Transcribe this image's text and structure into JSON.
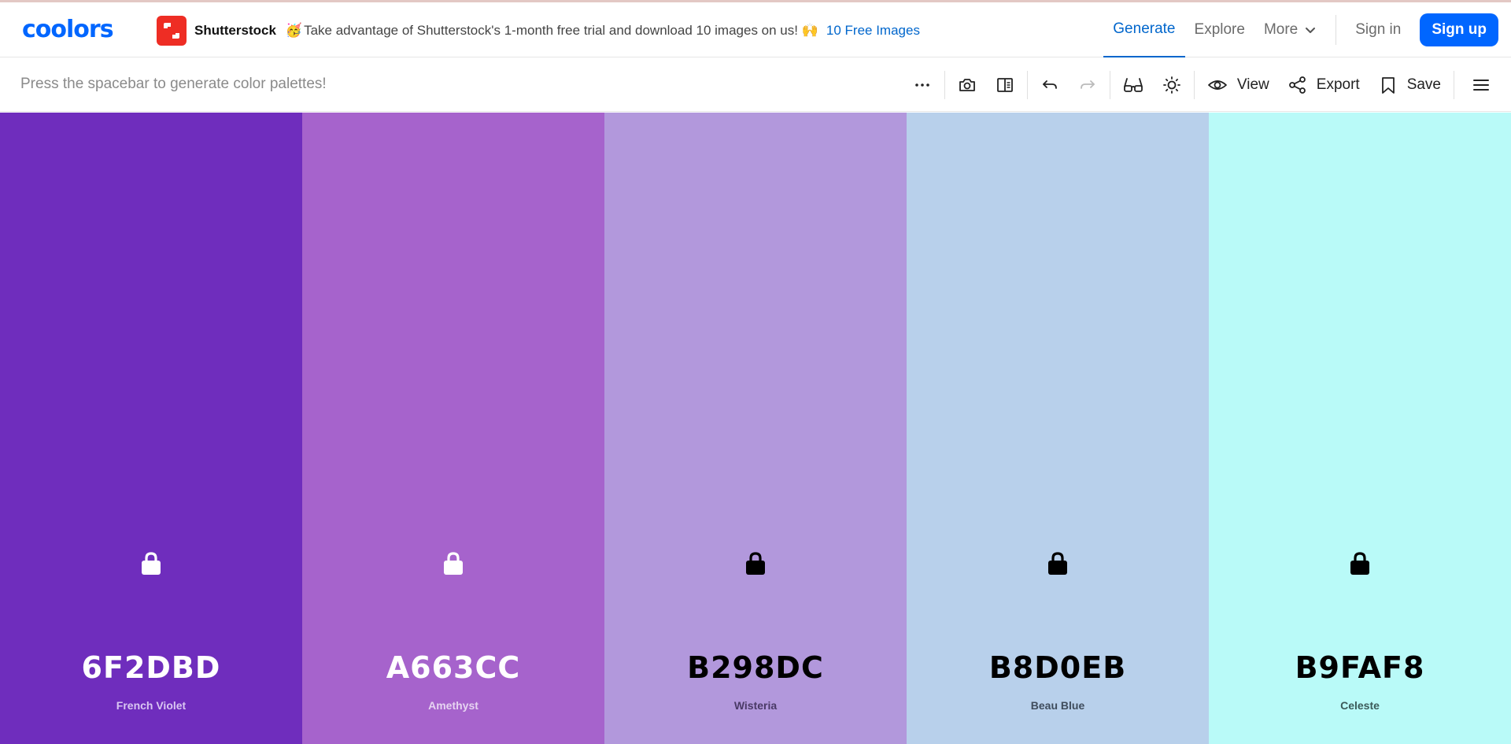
{
  "colors": {
    "brand": "#0066ff",
    "link": "#0066cc",
    "ad_logo": "#ee2d24"
  },
  "header": {
    "logo": "coolors",
    "ad": {
      "brand": "Shutterstock",
      "emoji": "🥳",
      "text": "Take advantage of Shutterstock's 1-month free trial and download 10 images on us! 🙌",
      "link": "10 Free Images"
    },
    "nav": {
      "generate": "Generate",
      "explore": "Explore",
      "more": "More",
      "sign_in": "Sign in",
      "sign_up": "Sign up"
    }
  },
  "toolbar": {
    "hint": "Press the spacebar to generate color palettes!",
    "view_label": "View",
    "export_label": "Export",
    "save_label": "Save",
    "icons": [
      "more-options-icon",
      "camera-icon",
      "panel-icon",
      "undo-icon",
      "redo-icon",
      "glasses-icon",
      "brightness-icon",
      "eye-icon",
      "share-icon",
      "bookmark-icon",
      "hamburger-menu-icon"
    ]
  },
  "palette": [
    {
      "hex": "6F2DBD",
      "name": "French Violet",
      "bg": "#6F2DBD",
      "fg": "#ffffff",
      "sub": "#d9c6f2",
      "locked": true
    },
    {
      "hex": "A663CC",
      "name": "Amethyst",
      "bg": "#A663CC",
      "fg": "#ffffff",
      "sub": "#e6d3f1",
      "locked": true
    },
    {
      "hex": "B298DC",
      "name": "Wisteria",
      "bg": "#B298DC",
      "fg": "#000000",
      "sub": "#4a3a66",
      "locked": true
    },
    {
      "hex": "B8D0EB",
      "name": "Beau Blue",
      "bg": "#B8D0EB",
      "fg": "#000000",
      "sub": "#3f4c5c",
      "locked": true
    },
    {
      "hex": "B9FAF8",
      "name": "Celeste",
      "bg": "#B9FAF8",
      "fg": "#000000",
      "sub": "#3b5a59",
      "locked": true
    }
  ]
}
